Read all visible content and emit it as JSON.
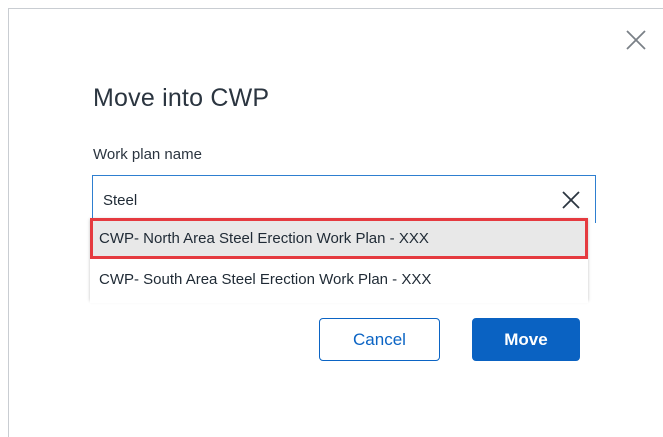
{
  "dialog": {
    "title": "Move into CWP",
    "close_icon": "close-icon"
  },
  "form": {
    "field_label": "Work plan name",
    "search_value": "Steel",
    "clear_icon": "clear-icon"
  },
  "dropdown": {
    "options": [
      {
        "label": "CWP- North Area Steel Erection Work Plan - XXX",
        "highlighted": true
      },
      {
        "label": "CWP- South Area Steel Erection Work Plan - XXX",
        "highlighted": false
      }
    ],
    "highlight_border_color": "#e53a3f"
  },
  "buttons": {
    "cancel_label": "Cancel",
    "move_label": "Move"
  },
  "colors": {
    "accent": "#0a62c2",
    "input_border": "#2e7fd0"
  }
}
